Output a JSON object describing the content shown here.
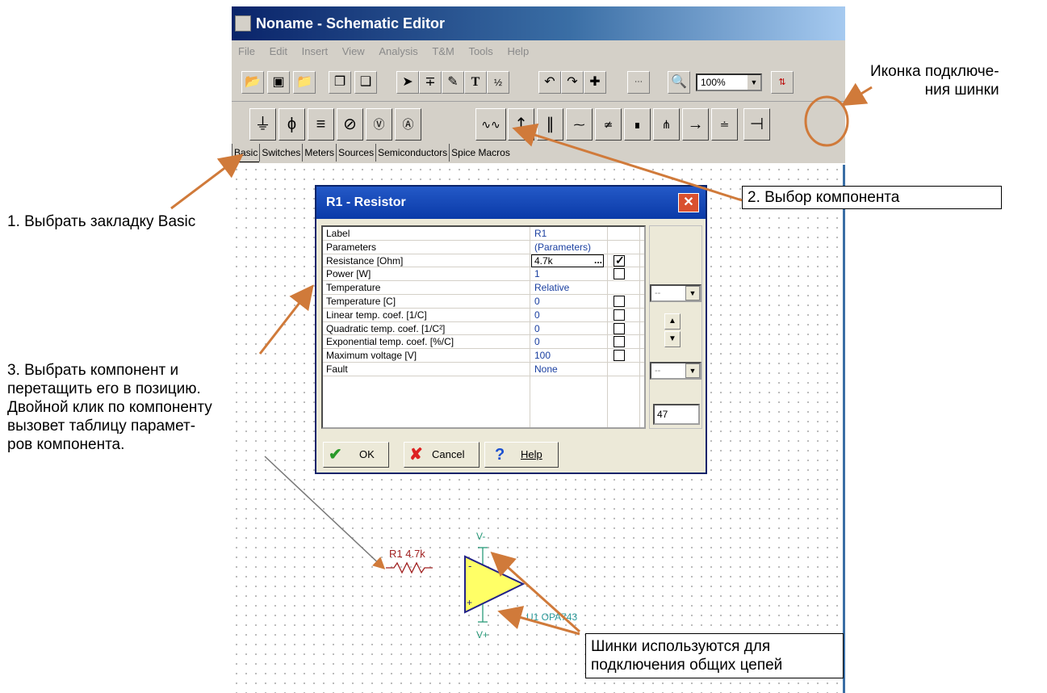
{
  "window": {
    "title": "Noname - Schematic Editor",
    "menu": [
      "File",
      "Edit",
      "Insert",
      "View",
      "Analysis",
      "T&M",
      "Tools",
      "Help"
    ],
    "zoom": "100%"
  },
  "component_tabs": [
    "Basic",
    "Switches",
    "Meters",
    "Sources",
    "Semiconductors",
    "Spice Macros"
  ],
  "dialog": {
    "title": "R1 - Resistor",
    "rows": [
      {
        "label": "Label",
        "value": "R1",
        "check": false,
        "has_check": false
      },
      {
        "label": "Parameters",
        "value": "(Parameters)",
        "check": false,
        "has_check": false
      },
      {
        "label": "Resistance [Ohm]",
        "value": "4.7k",
        "check": true,
        "has_check": true
      },
      {
        "label": "Power        [W]",
        "value": "1",
        "check": false,
        "has_check": true
      },
      {
        "label": "Temperature",
        "value": "Relative",
        "check": false,
        "has_check": false
      },
      {
        "label": "Temperature [C]",
        "value": "0",
        "check": false,
        "has_check": true
      },
      {
        "label": "Linear temp. coef. [1/C]",
        "value": "0",
        "check": false,
        "has_check": true
      },
      {
        "label": "Quadratic temp. coef. [1/C²]",
        "value": "0",
        "check": false,
        "has_check": true
      },
      {
        "label": "Exponential temp. coef. [%/C]",
        "value": "0",
        "check": false,
        "has_check": true
      },
      {
        "label": "Maximum voltage [V]",
        "value": "100",
        "check": false,
        "has_check": true
      },
      {
        "label": "Fault",
        "value": "None",
        "check": false,
        "has_check": false
      }
    ],
    "ellipsis": "...",
    "combo1": "--",
    "combo2": "--",
    "number": "47",
    "buttons": {
      "ok": "OK",
      "cancel": "Cancel",
      "help": "Help"
    }
  },
  "schematic": {
    "resistor_label": "R1 4.7k",
    "opamp_label": "U1 OPA743",
    "vminus": "V-",
    "vplus": "V+",
    "opamp_color": "#ffff66"
  },
  "annotations": {
    "bus_icon": [
      "Иконка подключе-",
      "ния шинки"
    ],
    "step1": "1. Выбрать закладку Basic",
    "step2": "2. Выбор компонента",
    "step3": [
      "3. Выбрать компонент и",
      "перетащить его в позицию.",
      "Двойной клик по компоненту",
      "вызовет таблицу парамет-",
      "ров компонента."
    ],
    "buses": [
      "Шинки используются для",
      "подключения общих цепей"
    ],
    "arrow_color": "#d07a3a"
  }
}
